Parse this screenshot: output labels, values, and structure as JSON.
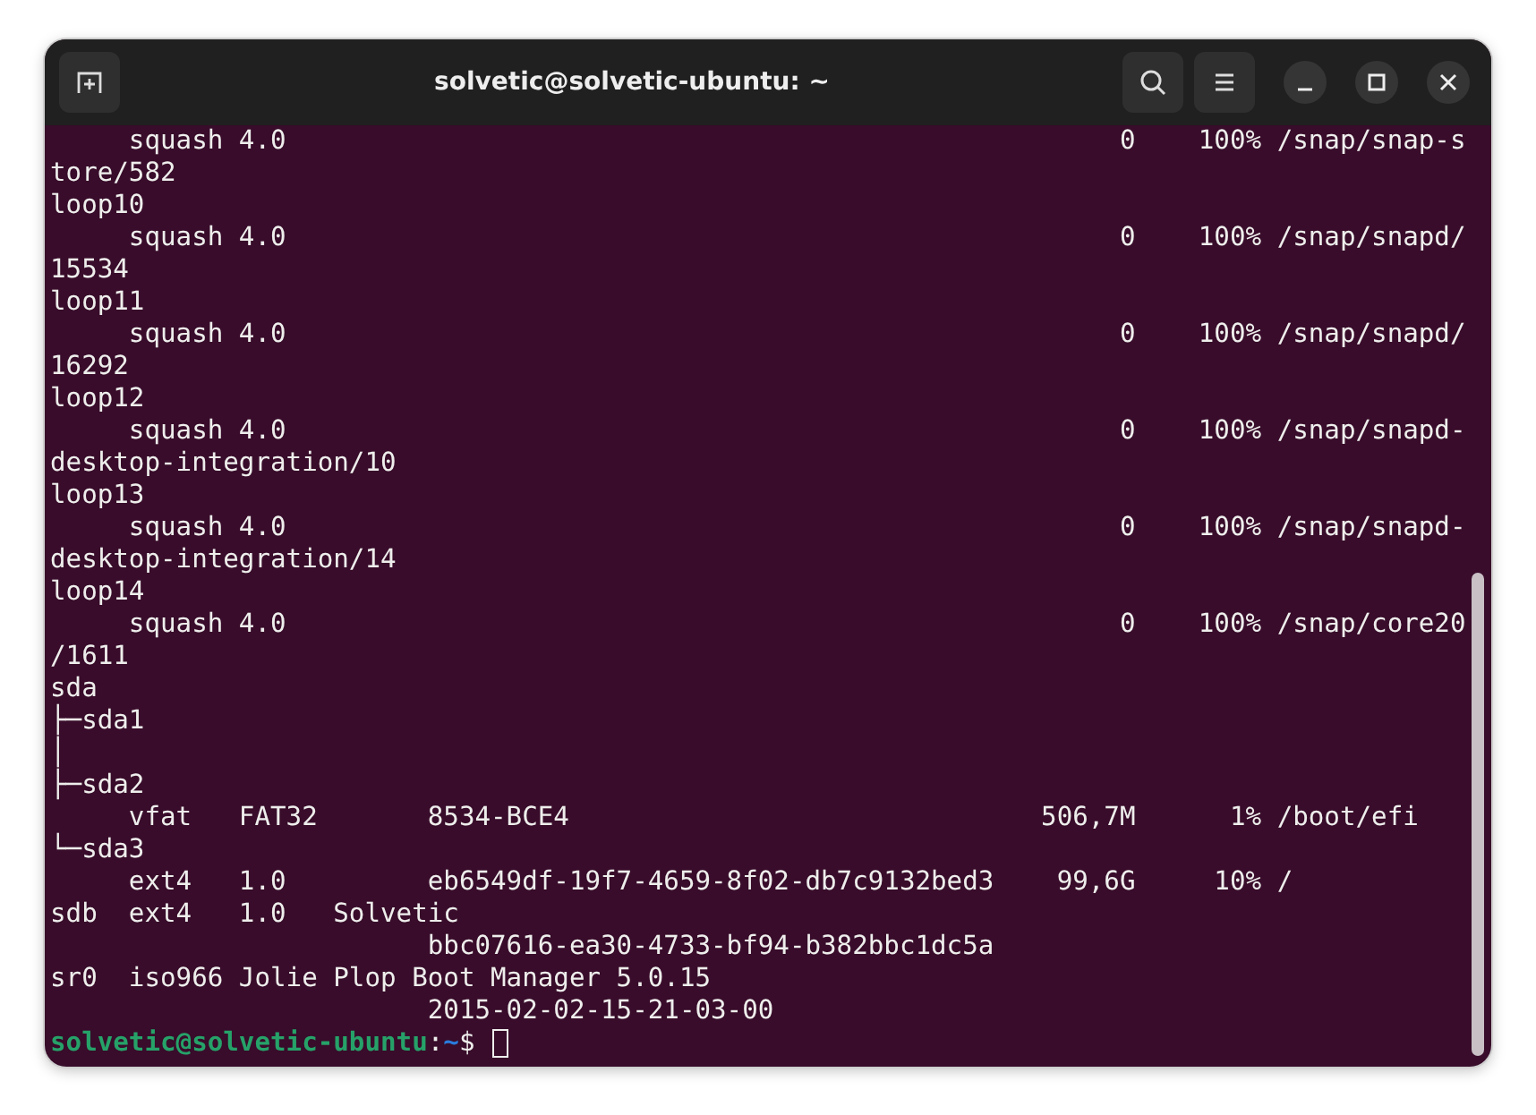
{
  "window": {
    "title": "solvetic@solvetic-ubuntu: ~"
  },
  "terminal": {
    "lines": [
      {
        "text": "     squash 4.0                                                     0    100% /snap/snap-s"
      },
      {
        "text": "tore/582"
      },
      {
        "text": "loop10"
      },
      {
        "text": "     squash 4.0                                                     0    100% /snap/snapd/"
      },
      {
        "text": "15534"
      },
      {
        "text": "loop11"
      },
      {
        "text": "     squash 4.0                                                     0    100% /snap/snapd/"
      },
      {
        "text": "16292"
      },
      {
        "text": "loop12"
      },
      {
        "text": "     squash 4.0                                                     0    100% /snap/snapd-"
      },
      {
        "text": "desktop-integration/10"
      },
      {
        "text": "loop13"
      },
      {
        "text": "     squash 4.0                                                     0    100% /snap/snapd-"
      },
      {
        "text": "desktop-integration/14"
      },
      {
        "text": "loop14"
      },
      {
        "text": "     squash 4.0                                                     0    100% /snap/core20"
      },
      {
        "text": "/1611"
      },
      {
        "text": "sda"
      },
      {
        "text": "├─sda1"
      },
      {
        "text": "│"
      },
      {
        "text": "├─sda2"
      },
      {
        "text": "     vfat   FAT32       8534-BCE4                              506,7M      1% /boot/efi"
      },
      {
        "text": "└─sda3"
      },
      {
        "text": "     ext4   1.0         eb6549df-19f7-4659-8f02-db7c9132bed3    99,6G     10% /"
      },
      {
        "text": "sdb  ext4   1.0   Solvetic"
      },
      {
        "text": "                        bbc07616-ea30-4733-bf94-b382bbc1dc5a"
      },
      {
        "text": "sr0  iso966 Jolie Plop Boot Manager 5.0.15"
      },
      {
        "text": "                        2015-02-02-15-21-03-00"
      }
    ],
    "prompt": {
      "user_host": "solvetic@solvetic-ubuntu",
      "separator": ":",
      "path": "~",
      "symbol": "$"
    }
  }
}
